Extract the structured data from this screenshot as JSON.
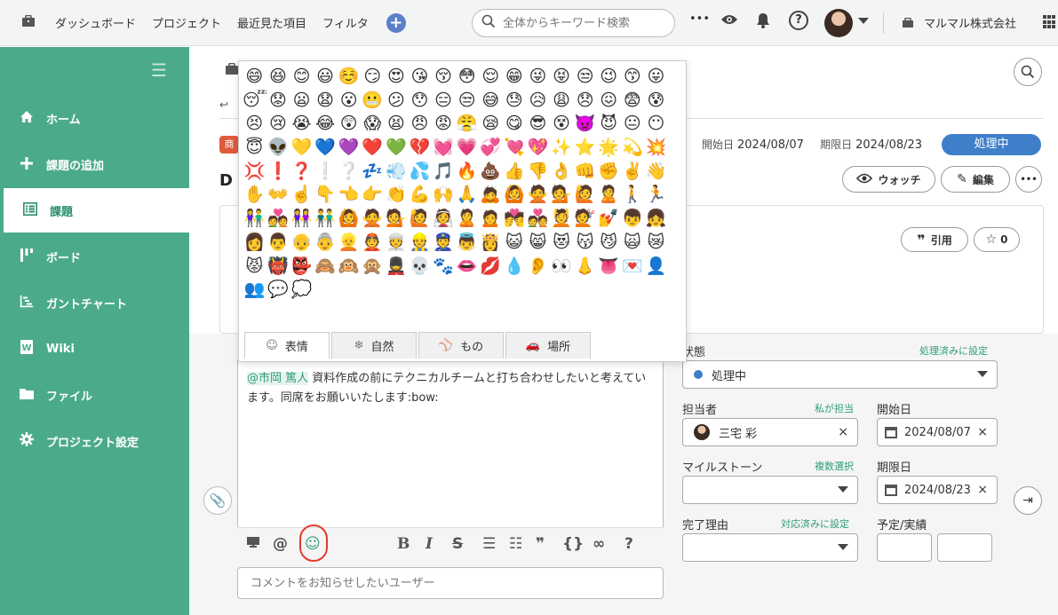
{
  "topbar": {
    "nav": [
      "ダッシュボード",
      "プロジェクト",
      "最近見た項目",
      "フィルタ"
    ],
    "plus_icon": "+",
    "search_placeholder": "全体からキーワード検索",
    "more_icon": "•••",
    "help_icon": "?",
    "company": "マルマル株式会社"
  },
  "sidebar": {
    "items": [
      {
        "label": "ホーム",
        "icon": "home-icon"
      },
      {
        "label": "課題の追加",
        "icon": "plus-icon"
      },
      {
        "label": "課題",
        "icon": "list-icon"
      },
      {
        "label": "ボード",
        "icon": "board-icon"
      },
      {
        "label": "ガントチャート",
        "icon": "gantt-icon"
      },
      {
        "label": "Wiki",
        "icon": "wiki-icon"
      },
      {
        "label": "ファイル",
        "icon": "folder-icon"
      },
      {
        "label": "プロジェクト設定",
        "icon": "gear-icon"
      }
    ]
  },
  "issue": {
    "tag": "商",
    "title_initial": "D",
    "start_label": "開始日",
    "start_date": "2024/08/07",
    "due_label": "期限日",
    "due_date": "2024/08/23",
    "status": "処理中",
    "watch_label": "ウォッチ",
    "edit_label": "編集",
    "quote_label": "引用",
    "star_count": "0",
    "more_icon": "•••"
  },
  "emoji_picker": {
    "emojis": [
      "😄",
      "😆",
      "😊",
      "😃",
      "☺️",
      "😏",
      "😍",
      "😘",
      "😚",
      "😳",
      "😌",
      "😁",
      "😜",
      "😝",
      "😒",
      "😉",
      "😙",
      "😛",
      "😴",
      "😟",
      "😦",
      "😧",
      "😮",
      "😬",
      "😕",
      "😯",
      "😑",
      "😒",
      "😅",
      "😓",
      "😥",
      "😩",
      "😞",
      "😖",
      "😨",
      "😰",
      "😣",
      "😢",
      "😭",
      "😂",
      "😲",
      "😱",
      "😫",
      "😠",
      "😡",
      "😤",
      "😪",
      "😋",
      "😎",
      "😵",
      "👿",
      "😈",
      "😐",
      "😶",
      "😇",
      "👽",
      "💛",
      "💙",
      "💜",
      "❤️",
      "💚",
      "💔",
      "💓",
      "💗",
      "💞",
      "💘",
      "💖",
      "✨",
      "⭐",
      "🌟",
      "💫",
      "💥",
      "💢",
      "❗",
      "❓",
      "❕",
      "❔",
      "💤",
      "💨",
      "💦",
      "🎵",
      "🔥",
      "💩",
      "👍",
      "👎",
      "👌",
      "👊",
      "✊",
      "✌️",
      "👋",
      "✋",
      "👐",
      "☝️",
      "👇",
      "👈",
      "👉",
      "👏",
      "💪",
      "🙌",
      "🙏",
      "🙇",
      "🙆",
      "🙅",
      "💁",
      "🙋",
      "🙎",
      "🚶",
      "🏃",
      "👫",
      "💑",
      "👭",
      "👬",
      "🙆",
      "🙅",
      "💁",
      "🙋",
      "👰",
      "🙎",
      "🙍",
      "💏",
      "💑",
      "💆",
      "💇",
      "💅",
      "👦",
      "👧",
      "👩",
      "👨",
      "👴",
      "👵",
      "👱",
      "👲",
      "👳",
      "👷",
      "👮",
      "👼",
      "👸",
      "😺",
      "😸",
      "😻",
      "😽",
      "😼",
      "🙀",
      "😿",
      "😾",
      "👹",
      "👺",
      "🙈",
      "🙉",
      "🙊",
      "💂",
      "💀",
      "🐾",
      "👄",
      "💋",
      "💧",
      "👂",
      "👀",
      "👃",
      "👅",
      "💌",
      "👤",
      "👥",
      "💬",
      "💭"
    ],
    "tabs": [
      {
        "label": "表情",
        "icon": "smile-icon",
        "glyph": "☺"
      },
      {
        "label": "自然",
        "icon": "snowflake-icon",
        "glyph": "❄"
      },
      {
        "label": "もの",
        "icon": "ball-icon",
        "glyph": "⚾"
      },
      {
        "label": "場所",
        "icon": "car-icon",
        "glyph": "🚗"
      }
    ]
  },
  "comment": {
    "mention": "@市岡 篤人",
    "body": " 資料作成の前にテクニカルチームと打ち合わせしたいと考えています。同席をお願いいたします:bow:",
    "notify_placeholder": "コメントをお知らせしたいユーザー",
    "toolbar": {
      "mention": "@",
      "emoji": "☺",
      "bold": "B",
      "italic": "I",
      "strike": "S",
      "bullet": "☰",
      "numbered": "☷",
      "quote": "❞",
      "code": "{}",
      "link": "∞",
      "help": "?"
    }
  },
  "form": {
    "status": {
      "label": "状態",
      "link": "処理済みに設定",
      "value": "処理中"
    },
    "assignee": {
      "label": "担当者",
      "link": "私が担当",
      "value": "三宅 彩"
    },
    "start": {
      "label": "開始日",
      "value": "2024/08/07"
    },
    "milestone": {
      "label": "マイルストーン",
      "link": "複数選択"
    },
    "due": {
      "label": "期限日",
      "value": "2024/08/23"
    },
    "resolution": {
      "label": "完了理由",
      "link": "対応済みに設定"
    },
    "estimate": {
      "label": "予定/実績"
    },
    "clear_icon": "×"
  },
  "colors": {
    "sidebar": "#4caa8c",
    "accent": "#2e9c7a",
    "status_blue": "#3f7fca",
    "highlight_red": "#e33b2f"
  }
}
